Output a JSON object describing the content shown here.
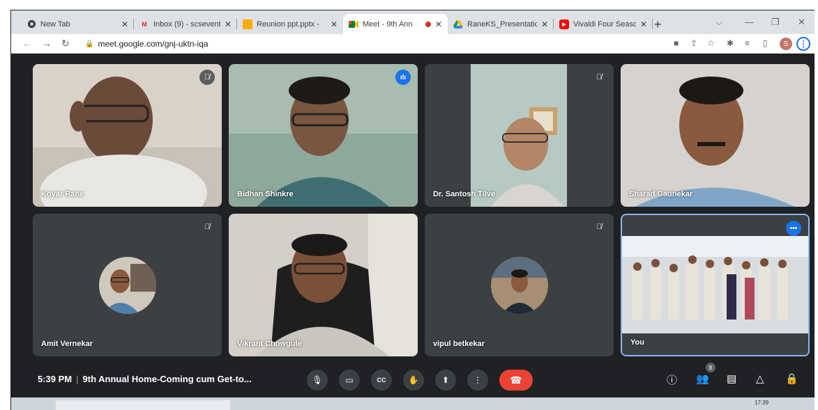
{
  "browser": {
    "tabs": [
      {
        "title": "New Tab",
        "icon": "chrome-icon"
      },
      {
        "title": "Inbox (9) - scsevent",
        "icon": "gmail-icon"
      },
      {
        "title": "Reunion ppt.pptx -",
        "icon": "slides-icon"
      },
      {
        "title": "Meet - 9th Ann",
        "icon": "meet-icon"
      },
      {
        "title": "RaneKS_Presentatic",
        "icon": "drive-icon"
      },
      {
        "title": "Vivaldi Four Season",
        "icon": "youtube-icon"
      }
    ],
    "url": "meet.google.com/gnj-uktn-iqa",
    "profile_initial": "S"
  },
  "participants": [
    {
      "name": "Koyar Rane",
      "muted": true
    },
    {
      "name": "Bidhan Shinkre",
      "speaking": true
    },
    {
      "name": "Dr. Santosh Tilve",
      "muted": true
    },
    {
      "name": "Sharad Gaunekar"
    },
    {
      "name": "Amit Vernekar",
      "muted": true
    },
    {
      "name": "Vikrant Chowgule"
    },
    {
      "name": "vipul betkekar",
      "muted": true
    },
    {
      "name": "You"
    }
  ],
  "meeting": {
    "time": "5:39 PM",
    "separator": "|",
    "title": "9th Annual Home-Coming cum Get-to...",
    "participant_count": "8"
  },
  "taskbar": {
    "time": "17:39"
  },
  "colors": {
    "end_call": "#ea4335",
    "accent": "#1a73e8",
    "bar_bg": "#202124"
  }
}
